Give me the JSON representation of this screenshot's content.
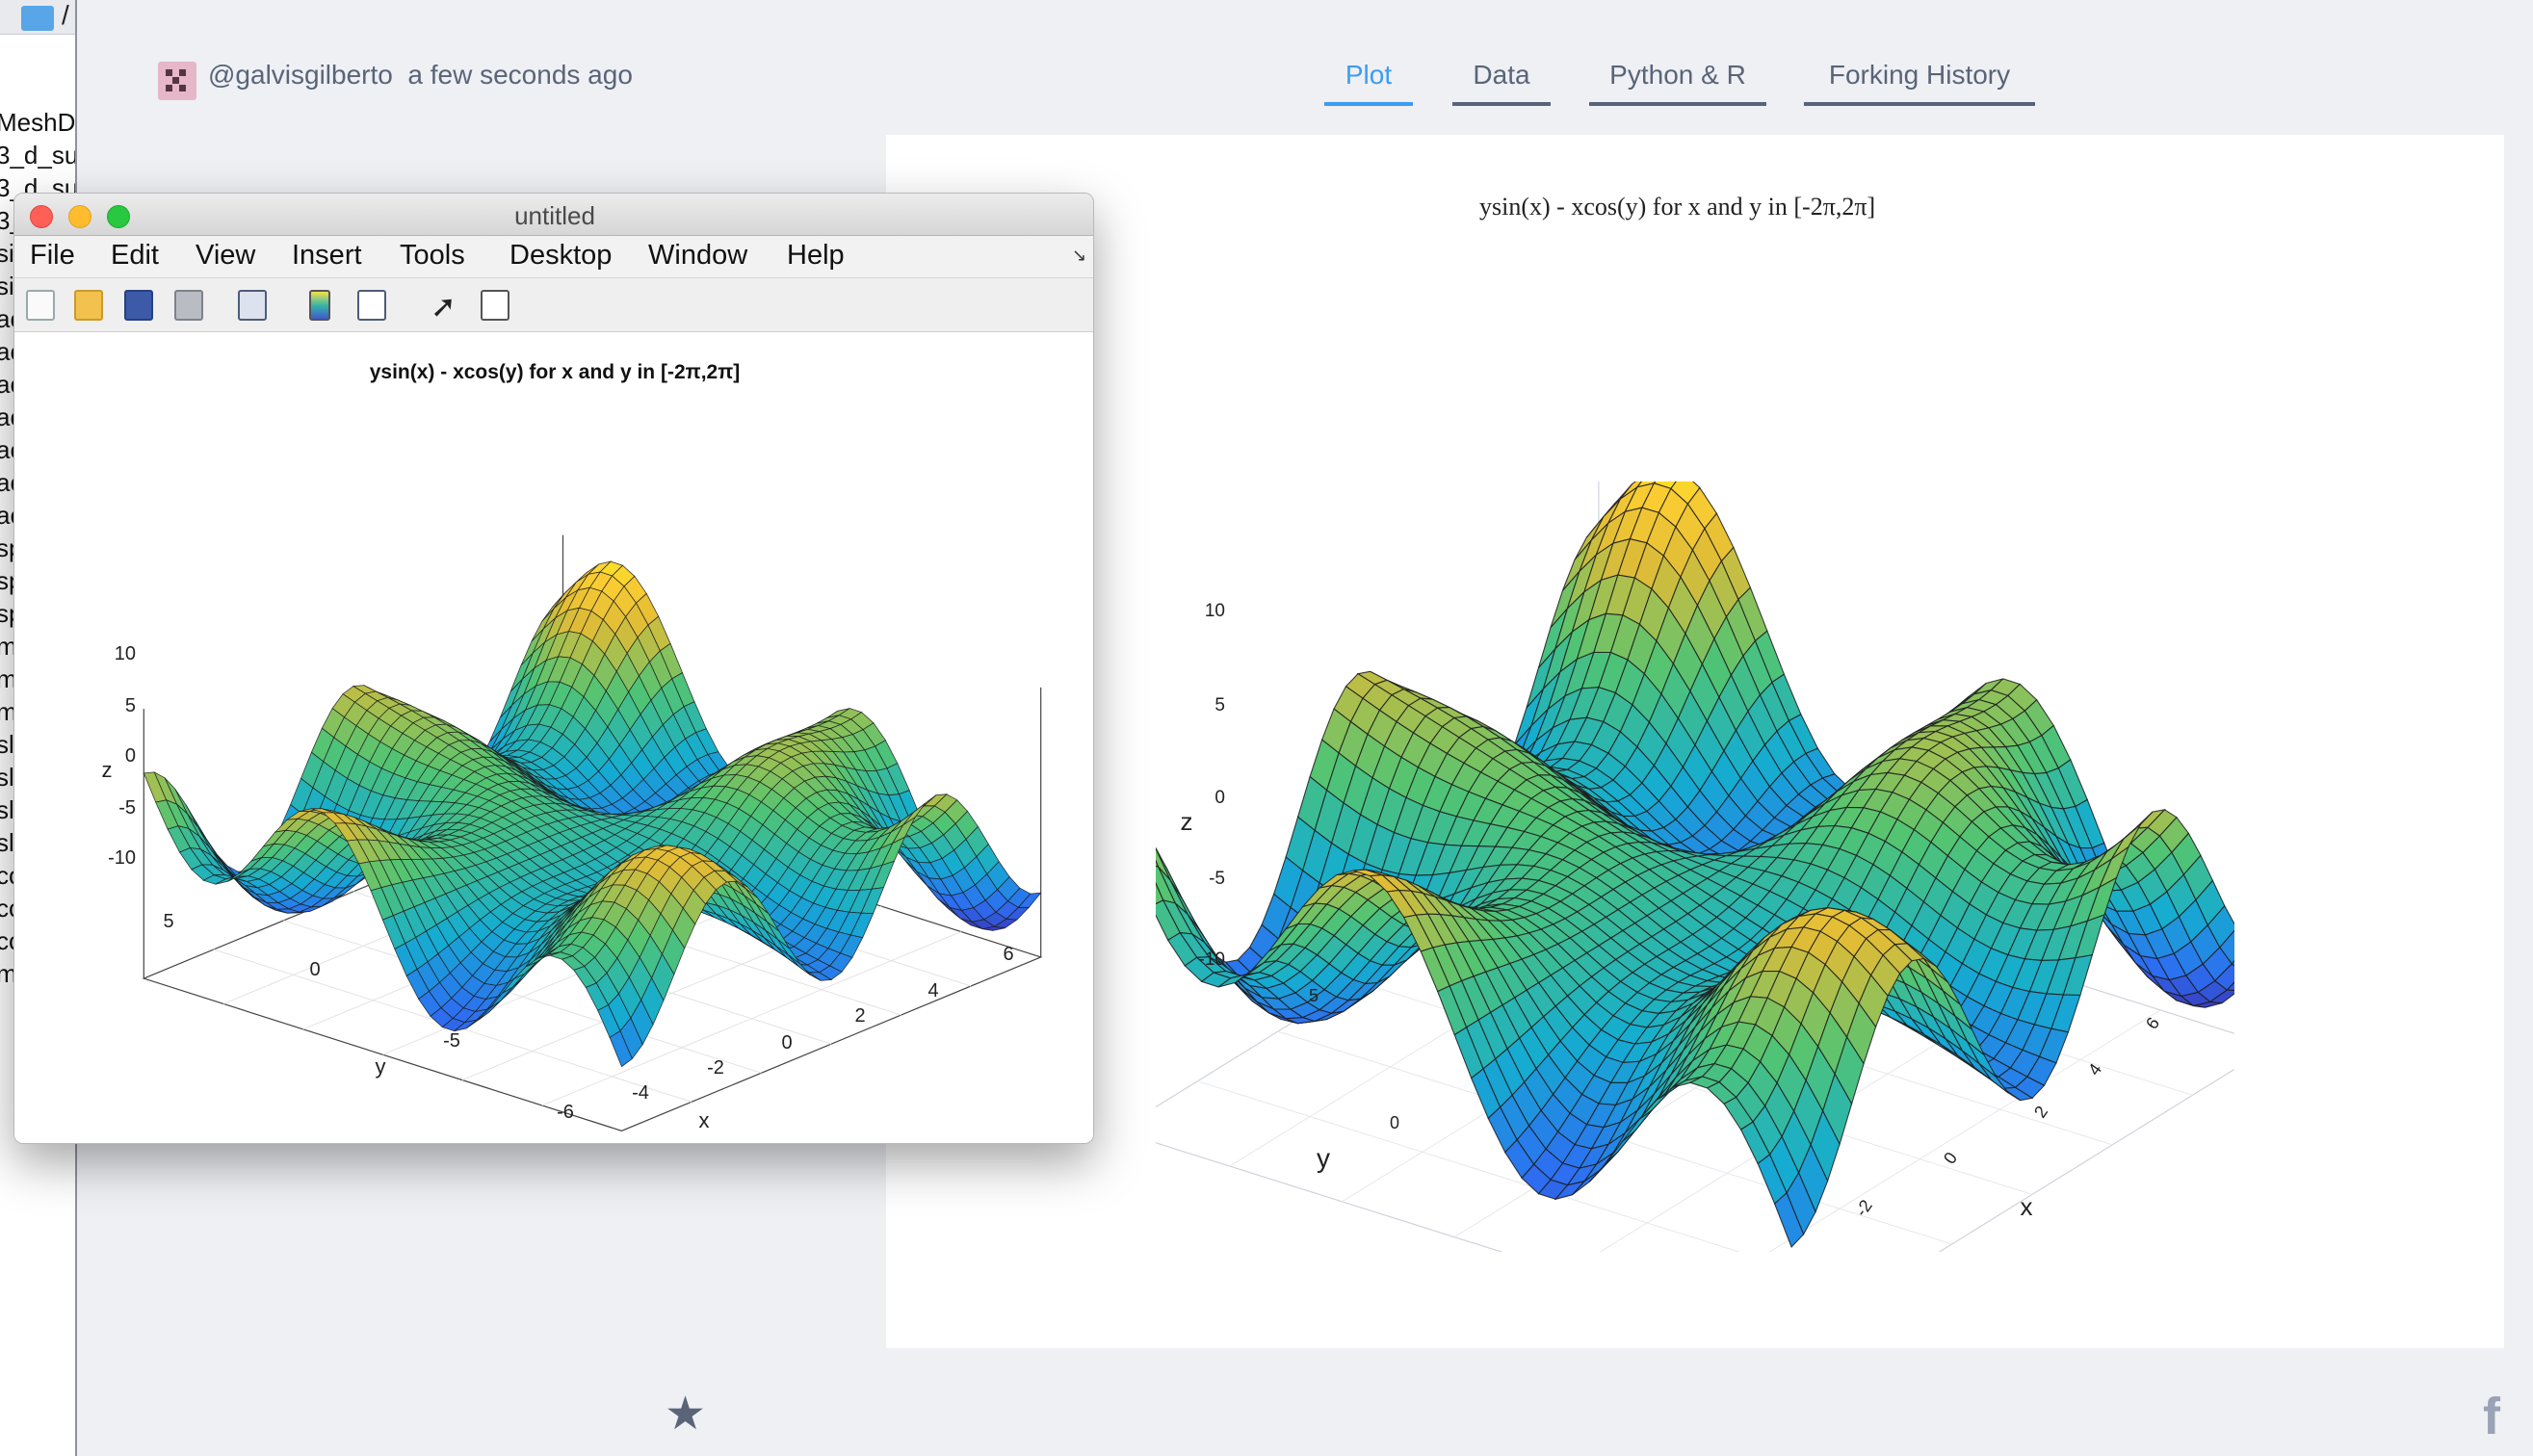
{
  "left_pane": {
    "path_sep": "/",
    "files": [
      "MeshDe",
      "3_d_su",
      "3_d_su",
      "3_",
      "si",
      "si",
      "ac",
      "ac",
      "ac",
      "ac",
      "ac",
      "ac",
      "ac",
      "sp",
      "sp",
      "sp",
      "m",
      "m",
      "m",
      "sl",
      "sl",
      "sl",
      "sl",
      "co",
      "co",
      "co",
      "m"
    ]
  },
  "plot_page": {
    "author": "@galvisgilberto",
    "timestamp": "a few seconds ago",
    "tabs": [
      "Plot",
      "Data",
      "Python & R",
      "Forking History"
    ],
    "active_tab": "Plot",
    "title": "ysin(x) - xcos(y) for x and y in [-2π,2π]",
    "axis_labels": {
      "x": "x",
      "y": "y",
      "z": "z"
    },
    "z_ticks": [
      "10",
      "5",
      "0",
      "-5",
      "-10"
    ],
    "x_ticks": [
      "6",
      "4",
      "2",
      "0",
      "-2"
    ],
    "y_ticks": [
      "5",
      "0"
    ],
    "colors": {
      "active_tab": "#3d9cf2",
      "tab": "#5a6478",
      "background": "#eef0f4"
    },
    "icons": [
      "star-icon",
      "facebook-icon"
    ]
  },
  "matlab_window": {
    "title": "untitled",
    "menus": [
      "File",
      "Edit",
      "View",
      "Insert",
      "Tools",
      "Desktop",
      "Window",
      "Help"
    ],
    "toolbar_icons": [
      "new-figure-icon",
      "open-file-icon",
      "save-icon",
      "print-icon",
      "link-icon",
      "colorbar-icon",
      "legend-icon",
      "pointer-icon",
      "property-editor-icon"
    ],
    "figure_title": "ysin(x) - xcos(y) for x and y in [-2π,2π]",
    "axis_labels": {
      "x": "x",
      "y": "y",
      "z": "z"
    },
    "z_ticks": [
      "10",
      "5",
      "0",
      "-5",
      "-10"
    ],
    "x_ticks": [
      "-6",
      "-4",
      "-2",
      "0",
      "2",
      "4",
      "6"
    ],
    "y_ticks": [
      "5",
      "0",
      "-5"
    ]
  },
  "chart_data": [
    {
      "type": "surface",
      "function": "z = y*sin(x) - x*cos(y)",
      "title": "ysin(x) - xcos(y) for x and y in [-2π,2π]",
      "xlabel": "x",
      "ylabel": "y",
      "zlabel": "z",
      "xlim": [
        -6.283,
        6.283
      ],
      "ylim": [
        -6.283,
        6.283
      ],
      "zlim": [
        -12,
        12
      ],
      "grid_size": 40,
      "colorscale": "parula",
      "grid": true,
      "renderer": "MATLAB"
    },
    {
      "type": "surface",
      "function": "z = y*sin(x) - x*cos(y)",
      "title": "ysin(x) - xcos(y) for x and y in [-2π,2π]",
      "xlabel": "x",
      "ylabel": "y",
      "zlabel": "z",
      "xlim": [
        -6.283,
        6.283
      ],
      "ylim": [
        -6.283,
        6.283
      ],
      "zlim": [
        -12,
        12
      ],
      "grid_size": 40,
      "colorscale": "parula",
      "grid": true,
      "renderer": "Plotly"
    }
  ]
}
